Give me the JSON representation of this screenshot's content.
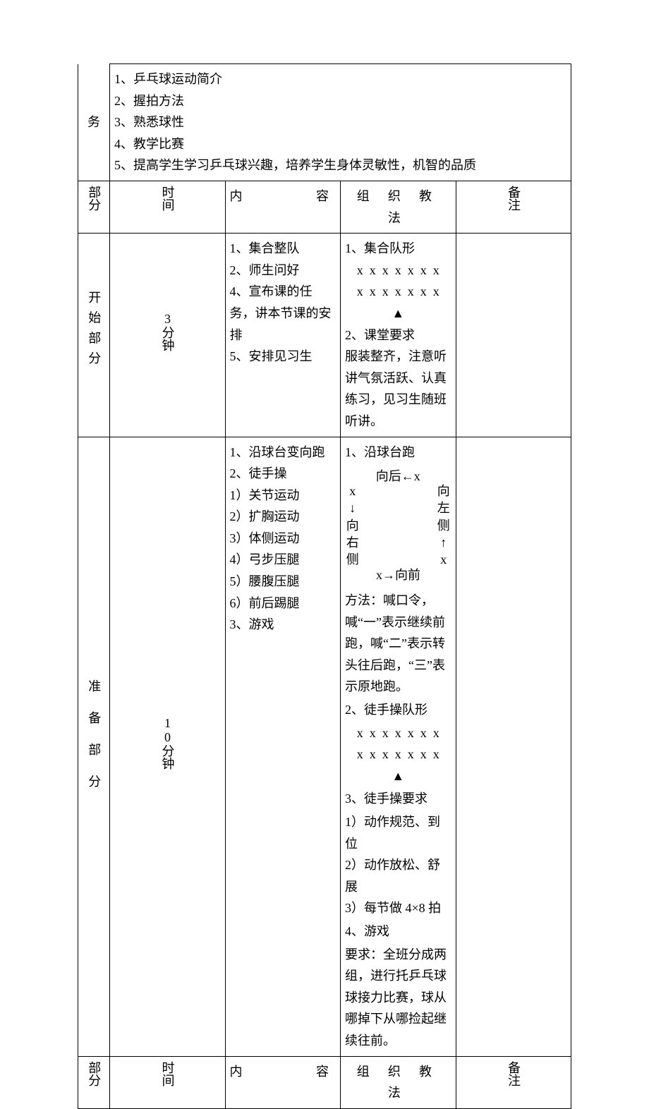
{
  "tasks": {
    "label": "务",
    "items": [
      "1、乒乓球运动简介",
      "2、握拍方法",
      "3、熟悉球性",
      "4、教学比赛",
      "5、提高学生学习乒乓球兴趣，培养学生身体灵敏性，机智的品质"
    ]
  },
  "header": {
    "section": "部分",
    "time": "时间",
    "content_left": "内",
    "content_right": "容",
    "method": "组 织 教 法",
    "note": "备注"
  },
  "rows": [
    {
      "section": "开始部分",
      "time": "3分钟",
      "content": [
        "1、集合整队",
        "2、师生问好",
        "4、宣布课的任务，讲本节课的安排",
        "5、安排见习生"
      ],
      "method": {
        "formation_title": "1、集合队形",
        "formation_lines": [
          "x  x  x  x  x  x  x",
          "x  x  x  x  x  x  x",
          "▲"
        ],
        "req_title": "2、课堂要求",
        "req_text": "服装整齐，注意听讲气氛活跃、认真练习，见习生随班听讲。"
      },
      "note": ""
    },
    {
      "section": "准备部分",
      "time": "10分钟",
      "content": [
        "1、沿球台变向跑",
        "2、徒手操",
        "1）关节运动",
        "2）扩胸运动",
        "3）体侧运动",
        "4）弓步压腿",
        "5）腰腹压腿",
        "6）前后踢腿",
        "3、游戏"
      ],
      "method": {
        "run_title": "1、沿球台跑",
        "run_top": "向后←x",
        "run_left": [
          "x",
          "↓",
          "向",
          "右",
          "侧"
        ],
        "run_right": [
          "向",
          "左",
          "侧",
          "↑",
          "x"
        ],
        "run_bottom": "x→向前",
        "run_desc": "方法：喊口令，喊“一”表示继续前跑，喊“二”表示转头往后跑，“三”表示原地跑。",
        "ex_form_title": "2、徒手操队形",
        "ex_form_lines": [
          "x  x  x  x  x  x  x",
          "x  x  x  x  x  x  x",
          "▲"
        ],
        "ex_req_title": "3、徒手操要求",
        "ex_req_items": [
          "1）动作规范、到位",
          "2）动作放松、舒展",
          "3）每节做 4×8 拍"
        ],
        "game_title": "4、游戏",
        "game_req": "要求：全班分成两组，进行托乒乓球球接力比赛，球从哪掉下从哪捡起继续往前。"
      },
      "note": ""
    }
  ]
}
